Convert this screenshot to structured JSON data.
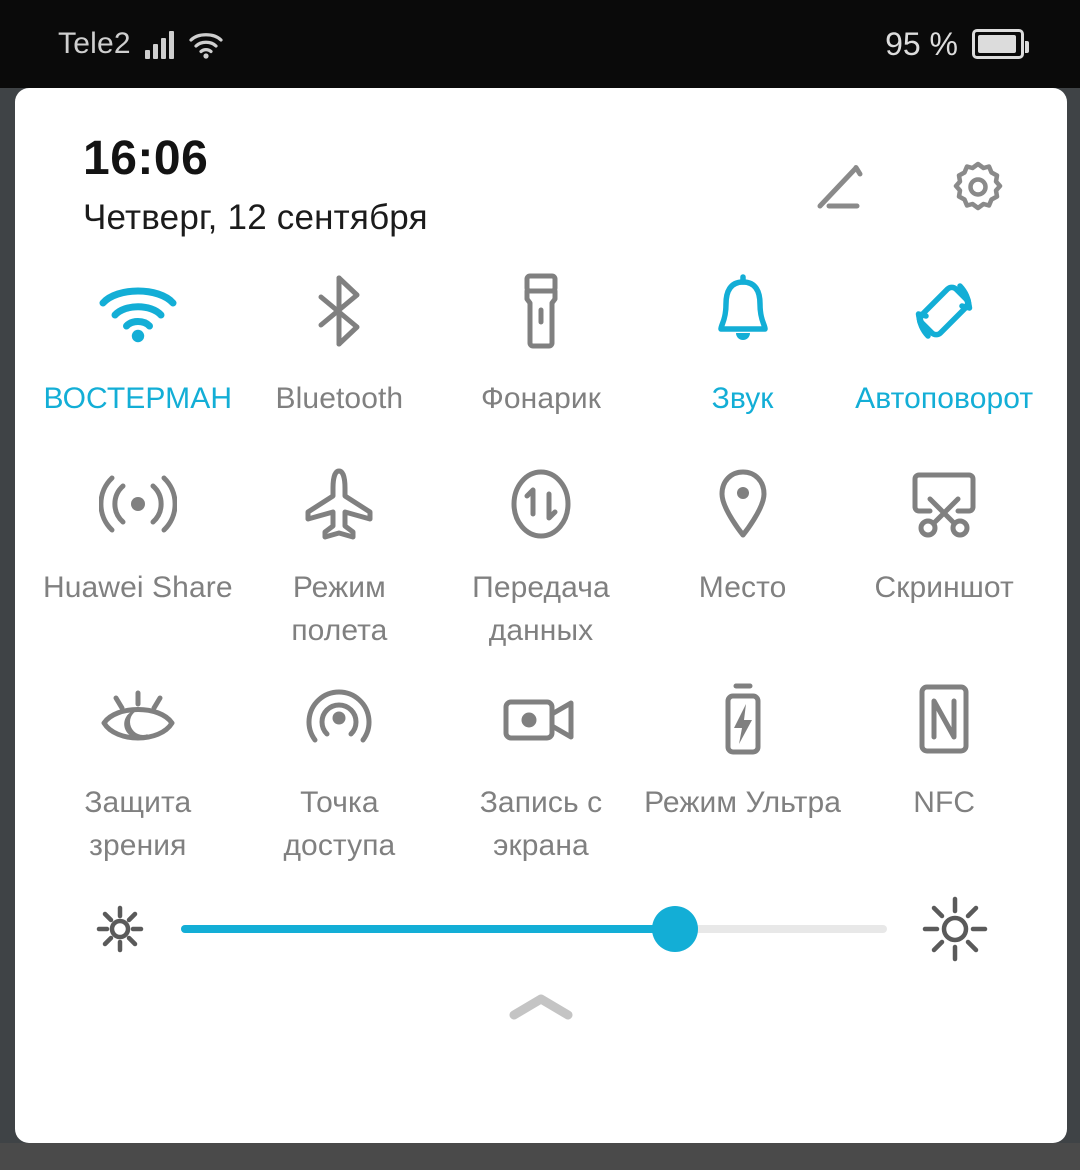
{
  "statusbar": {
    "carrier": "Tele2",
    "signal_icon": "signal-bars-icon",
    "wifi_icon": "wifi-icon",
    "battery_percent": "95 %",
    "battery_icon": "battery-icon"
  },
  "panel": {
    "clock": "16:06",
    "date": "Четверг, 12 сентября",
    "edit_icon": "pencil-edit-icon",
    "settings_icon": "gear-icon"
  },
  "colors": {
    "accent": "#13aed6",
    "inactive": "#808080",
    "panel_bg": "#ffffff",
    "statusbar_bg": "#0a0a0a",
    "screen_bg": "#3f4346"
  },
  "tiles": [
    [
      {
        "label": "ВОСТЕРМАН",
        "icon": "wifi-icon",
        "active": true
      },
      {
        "label": "Bluetooth",
        "icon": "bluetooth-icon",
        "active": false
      },
      {
        "label": "Фонарик",
        "icon": "flashlight-icon",
        "active": false
      },
      {
        "label": "Звук",
        "icon": "bell-sound-icon",
        "active": true
      },
      {
        "label": "Автоповорот",
        "icon": "auto-rotate-icon",
        "active": true
      }
    ],
    [
      {
        "label": "Huawei Share",
        "icon": "broadcast-share-icon",
        "active": false
      },
      {
        "label": "Режим\nполета",
        "icon": "airplane-icon",
        "active": false
      },
      {
        "label": "Передача\nданных",
        "icon": "data-transfer-icon",
        "active": false
      },
      {
        "label": "Место",
        "icon": "location-pin-icon",
        "active": false
      },
      {
        "label": "Скриншот",
        "icon": "screenshot-icon",
        "active": false
      }
    ],
    [
      {
        "label": "Защита\nзрения",
        "icon": "eye-comfort-icon",
        "active": false
      },
      {
        "label": "Точка\nдоступа",
        "icon": "hotspot-icon",
        "active": false
      },
      {
        "label": "Запись с\nэкрана",
        "icon": "screen-record-icon",
        "active": false
      },
      {
        "label": "Режим Ультра",
        "icon": "ultra-battery-icon",
        "active": false
      },
      {
        "label": "NFC",
        "icon": "nfc-icon",
        "active": false
      }
    ]
  ],
  "brightness": {
    "value_percent": 70,
    "low_icon": "brightness-low-icon",
    "high_icon": "brightness-high-icon"
  },
  "collapse": {
    "icon": "chevron-up-icon"
  }
}
